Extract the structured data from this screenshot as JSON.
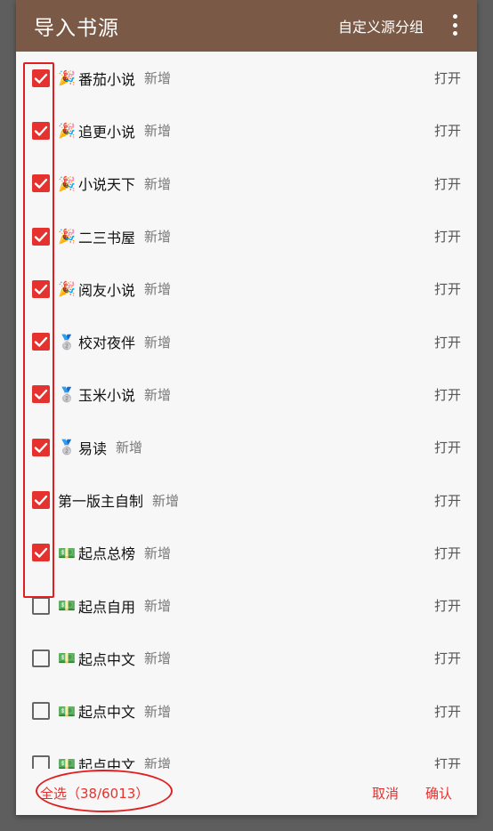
{
  "header": {
    "title": "导入书源",
    "group_button": "自定义源分组",
    "more_icon": "more-vert-icon"
  },
  "rows": [
    {
      "emoji": "🎉",
      "name": "番茄小说",
      "tag": "新增",
      "checked": true,
      "action": "打开"
    },
    {
      "emoji": "🎉",
      "name": "追更小说",
      "tag": "新增",
      "checked": true,
      "action": "打开"
    },
    {
      "emoji": "🎉",
      "name": "小说天下",
      "tag": "新增",
      "checked": true,
      "action": "打开"
    },
    {
      "emoji": "🎉",
      "name": "二三书屋",
      "tag": "新增",
      "checked": true,
      "action": "打开"
    },
    {
      "emoji": "🎉",
      "name": "阅友小说",
      "tag": "新增",
      "checked": true,
      "action": "打开"
    },
    {
      "emoji": "🥈",
      "name": "校对夜伴",
      "tag": "新增",
      "checked": true,
      "action": "打开"
    },
    {
      "emoji": "🥈",
      "name": "玉米小说",
      "tag": "新增",
      "checked": true,
      "action": "打开"
    },
    {
      "emoji": "🥈",
      "name": "易读",
      "tag": "新增",
      "checked": true,
      "action": "打开"
    },
    {
      "emoji": "",
      "name": "第一版主自制",
      "tag": "新增",
      "checked": true,
      "action": "打开"
    },
    {
      "emoji": "💵",
      "name": "起点总榜",
      "tag": "新增",
      "checked": true,
      "action": "打开"
    },
    {
      "emoji": "💵",
      "name": "起点自用",
      "tag": "新增",
      "checked": false,
      "action": "打开"
    },
    {
      "emoji": "💵",
      "name": "起点中文",
      "tag": "新增",
      "checked": false,
      "action": "打开"
    },
    {
      "emoji": "💵",
      "name": "起点中文",
      "tag": "新增",
      "checked": false,
      "action": "打开"
    },
    {
      "emoji": "💵",
      "name": "起点中文",
      "tag": "新增",
      "checked": false,
      "action": "打开"
    }
  ],
  "footer": {
    "select_all": "全选（38/6013）",
    "cancel": "取消",
    "confirm": "确认"
  },
  "colors": {
    "header_bg": "#7a5a46",
    "accent": "#e5322f",
    "annotation": "#e02020"
  }
}
